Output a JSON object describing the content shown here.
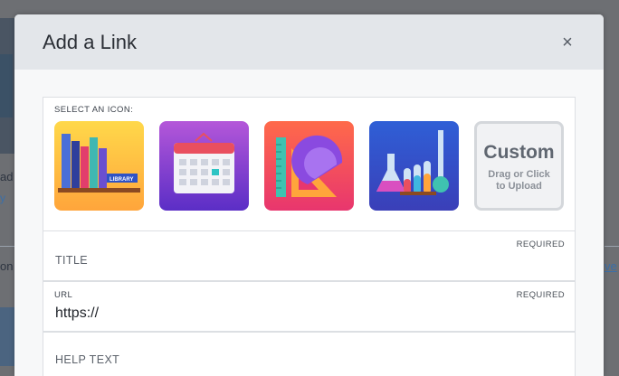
{
  "background": {
    "fragment_ad": "ad",
    "fragment_y": "y",
    "fragment_on": "on",
    "fragment_ve": "ve"
  },
  "modal": {
    "title": "Add a Link",
    "close_glyph": "×",
    "icon_section": {
      "label": "SELECT AN ICON:",
      "icons": [
        {
          "name": "library-books-icon",
          "badge_text": "LIBRARY"
        },
        {
          "name": "calendar-icon"
        },
        {
          "name": "ruler-protractor-icon"
        },
        {
          "name": "science-beakers-icon"
        }
      ],
      "custom": {
        "title": "Custom",
        "subtitle_line1": "Drag or Click",
        "subtitle_line2": "to Upload"
      }
    },
    "fields": {
      "title": {
        "placeholder": "TITLE",
        "required": "REQUIRED"
      },
      "url": {
        "label": "URL",
        "required": "REQUIRED",
        "value": "https://"
      },
      "help": {
        "placeholder": "HELP TEXT"
      }
    }
  },
  "colors": {
    "overlay": "#6d6f73",
    "header_bg": "#e3e6ea",
    "body_bg": "#f7f8f9"
  }
}
